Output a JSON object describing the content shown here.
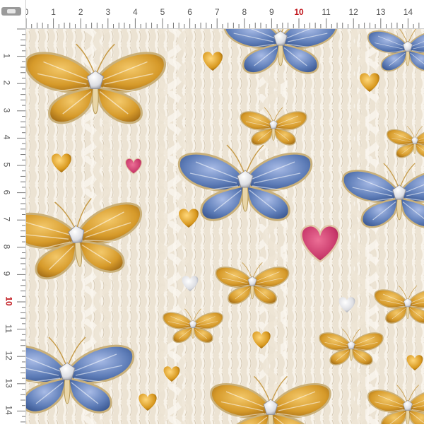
{
  "ruler": {
    "top_labels": [
      "0",
      "1",
      "2",
      "3",
      "4",
      "5",
      "6",
      "7",
      "8",
      "9",
      "10",
      "11",
      "12",
      "13",
      "14"
    ],
    "left_labels": [
      "1",
      "2",
      "3",
      "4",
      "5",
      "6",
      "7",
      "8",
      "9",
      "10",
      "11",
      "12",
      "13",
      "14"
    ],
    "accent_color": "#c0141a",
    "accent_label": "10"
  },
  "image": {
    "pattern": "embroidered butterflies and hearts on cream cable knit",
    "colors": {
      "knit": "#ece3d3",
      "gold": "#d69a2a",
      "blue": "#5e7db8",
      "pink": "#c8386a",
      "silver": "#e8e8ea"
    }
  }
}
